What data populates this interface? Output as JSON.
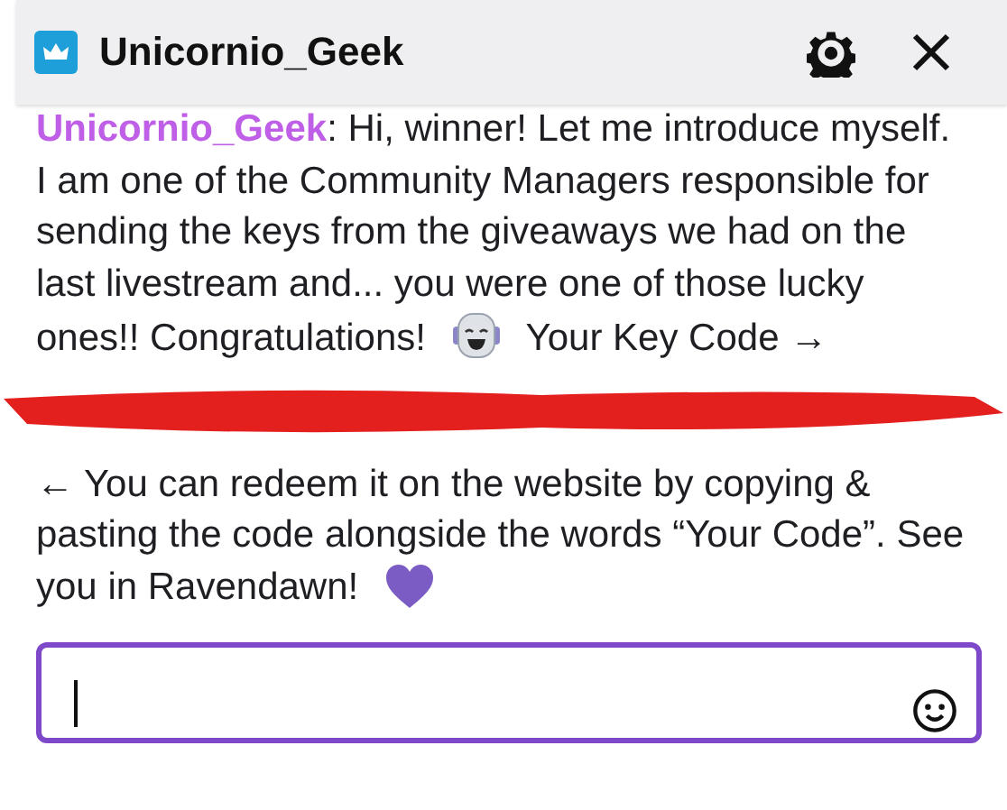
{
  "header": {
    "title": "Unicornio_Geek"
  },
  "message": {
    "username": "Unicornio_Geek",
    "text": ": Hi, winner! Let me introduce myself. I am one of the Community Managers responsible for sending the keys from the giveaways we had on the last livestream and... you were one of those lucky ones!! Congratulations!",
    "key_label": "Your Key Code →"
  },
  "redacted": true,
  "note": "← You can redeem it on the website by copying & pasting the code alongside the words “Your Code”. See you in Ravendawn!",
  "input": {
    "focused": true
  }
}
